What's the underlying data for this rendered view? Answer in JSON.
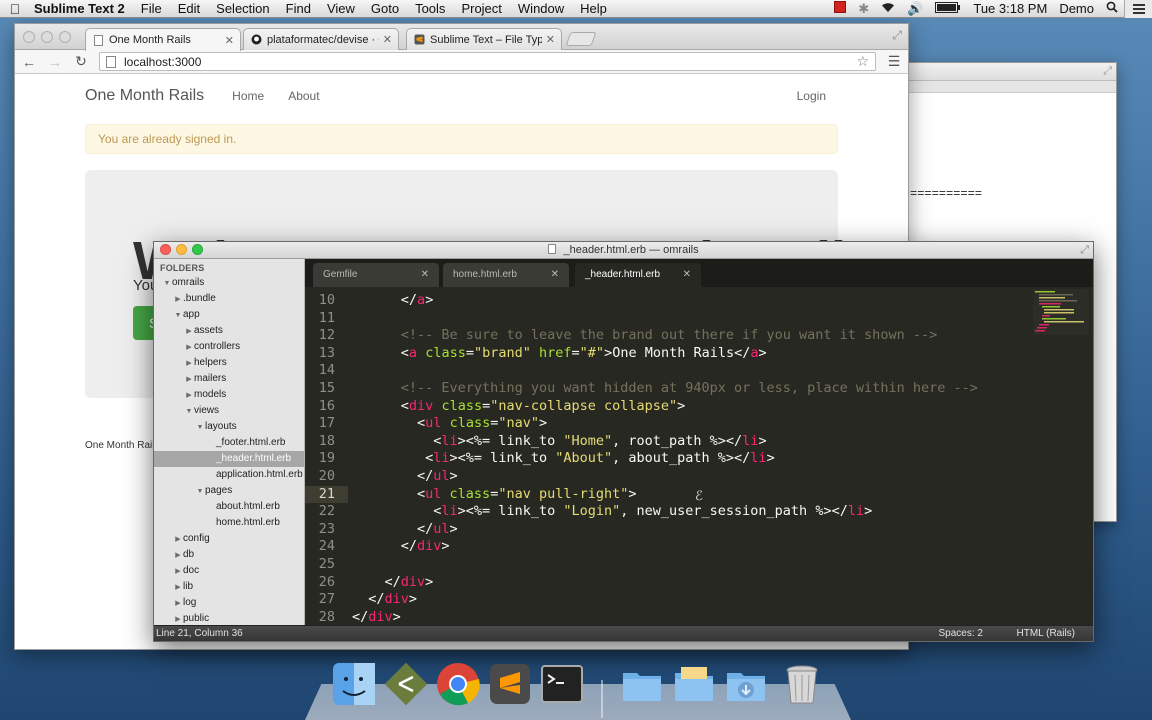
{
  "menubar": {
    "app": "Sublime Text 2",
    "items": [
      "File",
      "Edit",
      "Selection",
      "Find",
      "View",
      "Goto",
      "Tools",
      "Project",
      "Window",
      "Help"
    ],
    "time": "Tue 3:18 PM",
    "user": "Demo"
  },
  "browser": {
    "tabs": [
      {
        "title": "One Month Rails",
        "icon": "page-icon"
      },
      {
        "title": "plataformatec/devise · GitHu",
        "icon": "github-icon"
      },
      {
        "title": "Sublime Text – File Type Pre",
        "icon": "sublime-icon"
      }
    ],
    "url": "localhost:3000",
    "site": {
      "brand": "One Month Rails",
      "nav": [
        "Home",
        "About"
      ],
      "login": "Login",
      "alert": "You are already signed in.",
      "hero_title": "Welcome to One Month Rails",
      "hero_sub": "You",
      "hero_btn": "S",
      "footer": "One Month Rails"
    }
  },
  "back_window": {
    "equals_text": "=========="
  },
  "sublime": {
    "title": "_header.html.erb — omrails",
    "folders_label": "FOLDERS",
    "tree": [
      {
        "name": "omrails",
        "depth": 0,
        "arrow": "down"
      },
      {
        "name": ".bundle",
        "depth": 1,
        "arrow": "right"
      },
      {
        "name": "app",
        "depth": 1,
        "arrow": "down"
      },
      {
        "name": "assets",
        "depth": 2,
        "arrow": "right"
      },
      {
        "name": "controllers",
        "depth": 2,
        "arrow": "right"
      },
      {
        "name": "helpers",
        "depth": 2,
        "arrow": "right"
      },
      {
        "name": "mailers",
        "depth": 2,
        "arrow": "right"
      },
      {
        "name": "models",
        "depth": 2,
        "arrow": "right"
      },
      {
        "name": "views",
        "depth": 2,
        "arrow": "down"
      },
      {
        "name": "layouts",
        "depth": 3,
        "arrow": "down"
      },
      {
        "name": "_footer.html.erb",
        "depth": 4,
        "arrow": ""
      },
      {
        "name": "_header.html.erb",
        "depth": 4,
        "arrow": "",
        "selected": true
      },
      {
        "name": "application.html.erb",
        "depth": 4,
        "arrow": ""
      },
      {
        "name": "pages",
        "depth": 3,
        "arrow": "down"
      },
      {
        "name": "about.html.erb",
        "depth": 4,
        "arrow": ""
      },
      {
        "name": "home.html.erb",
        "depth": 4,
        "arrow": ""
      },
      {
        "name": "config",
        "depth": 1,
        "arrow": "right"
      },
      {
        "name": "db",
        "depth": 1,
        "arrow": "right"
      },
      {
        "name": "doc",
        "depth": 1,
        "arrow": "right"
      },
      {
        "name": "lib",
        "depth": 1,
        "arrow": "right"
      },
      {
        "name": "log",
        "depth": 1,
        "arrow": "right"
      },
      {
        "name": "public",
        "depth": 1,
        "arrow": "right"
      }
    ],
    "tabs": [
      {
        "title": "Gemfile",
        "active": false
      },
      {
        "title": "home.html.erb",
        "active": false
      },
      {
        "title": "_header.html.erb",
        "active": true
      }
    ],
    "current_line": 21,
    "lines": [
      {
        "n": 10,
        "tokens": [
          [
            "t",
            "      "
          ],
          [
            "g",
            "</"
          ],
          [
            "k",
            "a"
          ],
          [
            "g",
            ">"
          ]
        ]
      },
      {
        "n": 11,
        "tokens": []
      },
      {
        "n": 12,
        "tokens": [
          [
            "t",
            "      "
          ],
          [
            "c",
            "<!-- Be sure to leave the brand out there if you want it shown -->"
          ]
        ]
      },
      {
        "n": 13,
        "tokens": [
          [
            "t",
            "      "
          ],
          [
            "g",
            "<"
          ],
          [
            "k",
            "a "
          ],
          [
            "a",
            "class"
          ],
          [
            "t",
            "="
          ],
          [
            "s",
            "\"brand\""
          ],
          [
            "t",
            " "
          ],
          [
            "a",
            "href"
          ],
          [
            "t",
            "="
          ],
          [
            "s",
            "\"#\""
          ],
          [
            "t",
            ">One Month Rails</"
          ],
          [
            "k",
            "a"
          ],
          [
            "t",
            ">"
          ]
        ]
      },
      {
        "n": 14,
        "tokens": []
      },
      {
        "n": 15,
        "tokens": [
          [
            "t",
            "      "
          ],
          [
            "c",
            "<!-- Everything you want hidden at 940px or less, place within here -->"
          ]
        ]
      },
      {
        "n": 16,
        "tokens": [
          [
            "t",
            "      "
          ],
          [
            "g",
            "<"
          ],
          [
            "k",
            "div "
          ],
          [
            "a",
            "class"
          ],
          [
            "t",
            "="
          ],
          [
            "s",
            "\"nav-collapse collapse\""
          ],
          [
            "t",
            ">"
          ]
        ]
      },
      {
        "n": 17,
        "tokens": [
          [
            "t",
            "        "
          ],
          [
            "g",
            "<"
          ],
          [
            "k",
            "ul "
          ],
          [
            "a",
            "class"
          ],
          [
            "t",
            "="
          ],
          [
            "s",
            "\"nav\""
          ],
          [
            "t",
            ">"
          ]
        ]
      },
      {
        "n": 18,
        "tokens": [
          [
            "t",
            "          <"
          ],
          [
            "k",
            "li"
          ],
          [
            "t",
            "><%= link_to "
          ],
          [
            "s",
            "\"Home\""
          ],
          [
            "t",
            ", root_path %></"
          ],
          [
            "k",
            "li"
          ],
          [
            "t",
            ">"
          ]
        ]
      },
      {
        "n": 19,
        "tokens": [
          [
            "t",
            "         <"
          ],
          [
            "k",
            "li"
          ],
          [
            "t",
            "><%= link_to "
          ],
          [
            "s",
            "\"About\""
          ],
          [
            "t",
            ", about_path %></"
          ],
          [
            "k",
            "li"
          ],
          [
            "t",
            ">"
          ]
        ]
      },
      {
        "n": 20,
        "tokens": [
          [
            "t",
            "        </"
          ],
          [
            "k",
            "ul"
          ],
          [
            "t",
            ">"
          ]
        ]
      },
      {
        "n": 21,
        "tokens": [
          [
            "t",
            "        <"
          ],
          [
            "k",
            "ul "
          ],
          [
            "a",
            "class"
          ],
          [
            "t",
            "="
          ],
          [
            "s",
            "\"nav pull-right\""
          ],
          [
            "t",
            ">"
          ]
        ]
      },
      {
        "n": 22,
        "tokens": [
          [
            "t",
            "          <"
          ],
          [
            "k",
            "li"
          ],
          [
            "t",
            "><%= link_to "
          ],
          [
            "s",
            "\"Login\""
          ],
          [
            "t",
            ", new_user_session_path %></"
          ],
          [
            "k",
            "li"
          ],
          [
            "t",
            ">"
          ]
        ]
      },
      {
        "n": 23,
        "tokens": [
          [
            "t",
            "        </"
          ],
          [
            "k",
            "ul"
          ],
          [
            "t",
            ">"
          ]
        ]
      },
      {
        "n": 24,
        "tokens": [
          [
            "t",
            "      </"
          ],
          [
            "k",
            "div"
          ],
          [
            "t",
            ">"
          ]
        ]
      },
      {
        "n": 25,
        "tokens": []
      },
      {
        "n": 26,
        "tokens": [
          [
            "t",
            "    </"
          ],
          [
            "k",
            "div"
          ],
          [
            "t",
            ">"
          ]
        ]
      },
      {
        "n": 27,
        "tokens": [
          [
            "t",
            "  </"
          ],
          [
            "k",
            "div"
          ],
          [
            "t",
            ">"
          ]
        ]
      },
      {
        "n": 28,
        "tokens": [
          [
            "t",
            "</"
          ],
          [
            "k",
            "div"
          ],
          [
            "t",
            ">"
          ]
        ]
      }
    ],
    "status_position": "Line 21, Column 36",
    "status_spaces": "Spaces: 2",
    "status_syntax": "HTML (Rails)"
  },
  "dock": {
    "icons": [
      "finder-icon",
      "git-icon",
      "chrome-icon",
      "sublime-icon",
      "terminal-icon",
      "folder-icon",
      "documents-icon",
      "downloads-icon",
      "trash-icon"
    ]
  },
  "colors": {
    "tag": "#f92672",
    "attr": "#a6e22e",
    "string": "#e6db74",
    "comment": "#75715e",
    "editor_bg": "#272822",
    "alert_text": "#c09853"
  }
}
